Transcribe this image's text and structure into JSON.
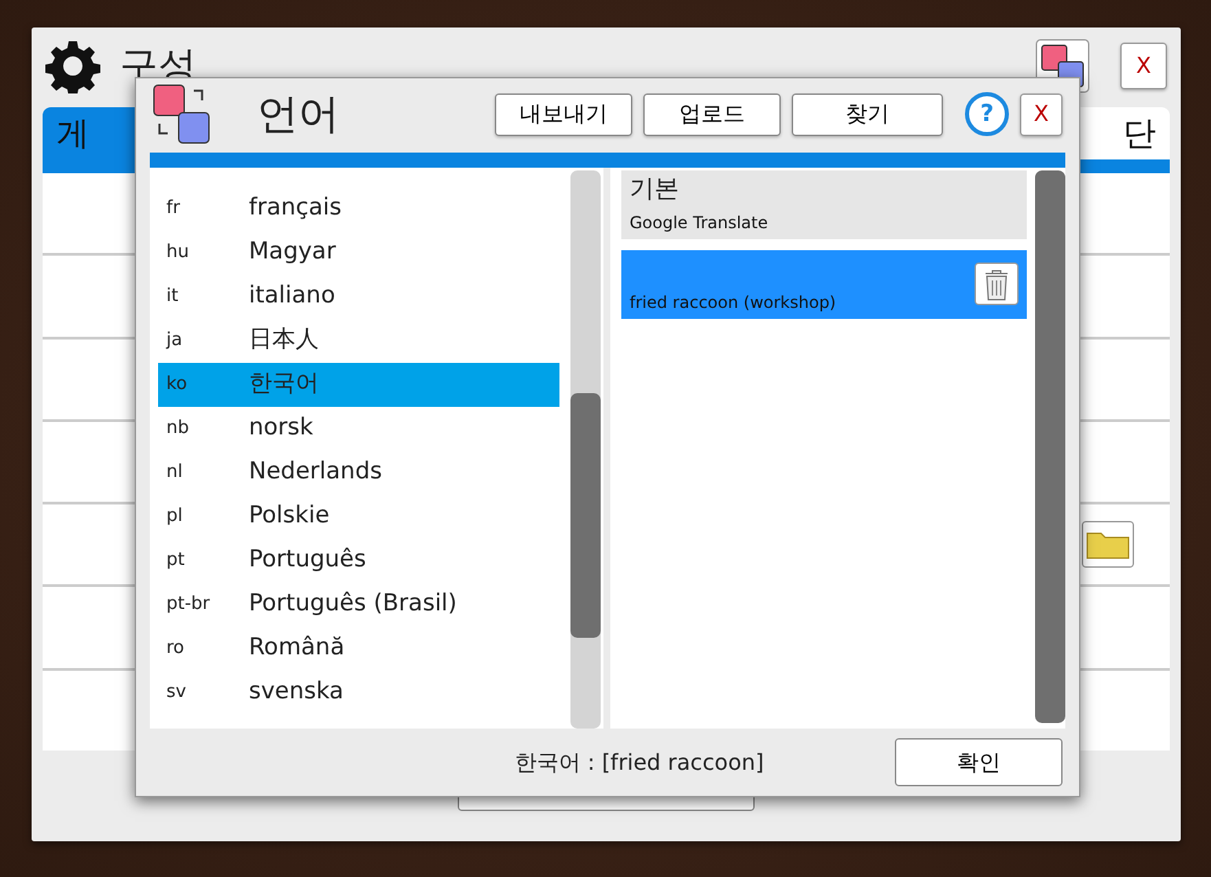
{
  "back_window": {
    "title": "구성",
    "close": "X",
    "tabs": [
      {
        "label": "게",
        "selected": true
      },
      {
        "label": "단",
        "selected": false
      }
    ]
  },
  "dialog": {
    "title": "언어",
    "buttons": [
      "내보내기",
      "업로드",
      "찾기"
    ],
    "help": "?",
    "close": "X",
    "languages": [
      {
        "code": "fr",
        "name": "français",
        "selected": false
      },
      {
        "code": "hu",
        "name": "Magyar",
        "selected": false
      },
      {
        "code": "it",
        "name": "italiano",
        "selected": false
      },
      {
        "code": "ja",
        "name": "日本人",
        "selected": false
      },
      {
        "code": "ko",
        "name": "한국어",
        "selected": true
      },
      {
        "code": "nb",
        "name": "norsk",
        "selected": false
      },
      {
        "code": "nl",
        "name": "Nederlands",
        "selected": false
      },
      {
        "code": "pl",
        "name": "Polskie",
        "selected": false
      },
      {
        "code": "pt",
        "name": "Português",
        "selected": false
      },
      {
        "code": "pt-br",
        "name": "Português (Brasil)",
        "selected": false
      },
      {
        "code": "ro",
        "name": "Română",
        "selected": false
      },
      {
        "code": "sv",
        "name": "svenska",
        "selected": false
      }
    ],
    "translations": [
      {
        "title": "기본",
        "source": "Google Translate",
        "selected": false,
        "deletable": false
      },
      {
        "source": "fried raccoon (workshop)",
        "selected": true,
        "deletable": true
      }
    ],
    "status": "한국어 : [fried raccoon]",
    "ok": "확인"
  }
}
